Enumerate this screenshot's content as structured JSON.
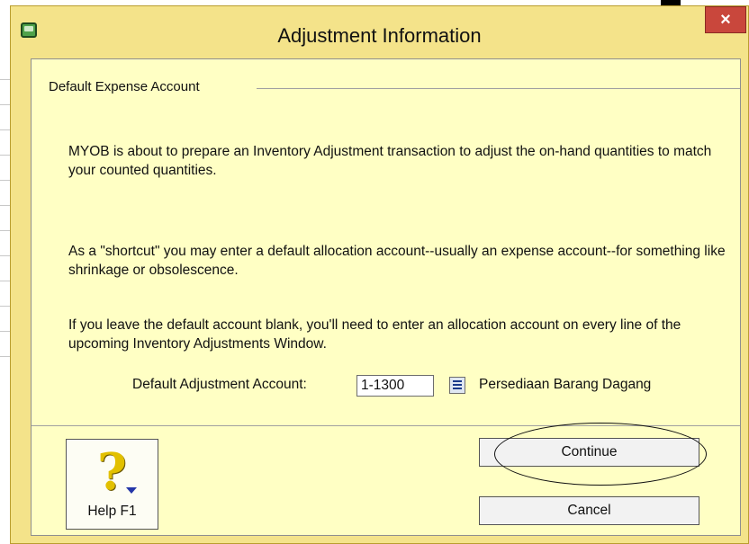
{
  "window": {
    "title": "Adjustment Information",
    "close_label": "×"
  },
  "group": {
    "legend": "Default Expense Account"
  },
  "paragraphs": {
    "p1": "MYOB is about to prepare an Inventory Adjustment transaction to adjust the on-hand quantities to match your counted quantities.",
    "p2": "As a \"shortcut\" you may enter a default allocation account--usually an expense account--for something like shrinkage or obsolescence.",
    "p3": "If you leave the default account blank, you'll need to enter an allocation account on every line of the upcoming Inventory Adjustments Window."
  },
  "field": {
    "label": "Default Adjustment Account:",
    "value": "1-1300",
    "account_name": "Persediaan Barang Dagang"
  },
  "buttons": {
    "help_label": "Help F1",
    "continue_label": "Continue",
    "cancel_label": "Cancel"
  },
  "icons": {
    "app": "myob-app-icon",
    "close": "close-icon",
    "lookup": "list-lookup-icon",
    "help": "help-question-icon"
  },
  "colors": {
    "titlebar": "#f4e38a",
    "client": "#ffffc4",
    "close": "#c9473c"
  }
}
